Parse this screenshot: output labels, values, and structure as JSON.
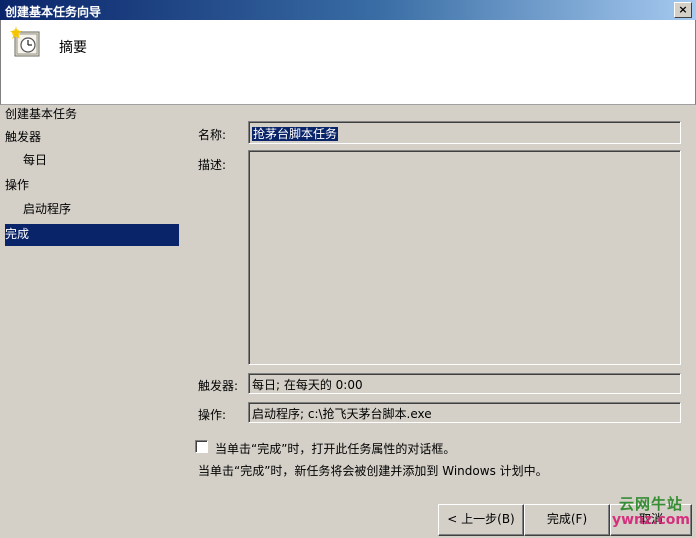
{
  "window": {
    "title": "创建基本任务向导",
    "close_glyph": "×"
  },
  "header": {
    "title": "摘要",
    "icon": "scheduled-task-clock-icon"
  },
  "nav": {
    "items": [
      {
        "label": "创建基本任务"
      },
      {
        "label": "触发器"
      },
      {
        "label": "每日"
      },
      {
        "label": "操作"
      },
      {
        "label": "启动程序"
      },
      {
        "label": "完成"
      }
    ]
  },
  "form": {
    "name_label": "名称:",
    "name_value": "抢茅台脚本任务",
    "description_label": "描述:",
    "description_value": "",
    "trigger_label": "触发器:",
    "trigger_value": "每日; 在每天的 0:00",
    "action_label": "操作:",
    "action_value": "启动程序; c:\\抢飞天茅台脚本.exe",
    "open_props_checkbox_label": "当单击“完成”时，打开此任务属性的对话框。",
    "open_props_checked": false,
    "info_text": "当单击“完成”时，新任务将会被创建并添加到 Windows 计划中。"
  },
  "buttons": {
    "back": "< 上一步(B)",
    "finish": "完成(F)",
    "cancel": "取消"
  },
  "watermark": {
    "line1": "云网牛站",
    "line2": "ywnz.com"
  },
  "colors": {
    "selection": "#0a246a",
    "dialog_bg": "#d4d0c8",
    "header_bg": "#ffffff"
  }
}
